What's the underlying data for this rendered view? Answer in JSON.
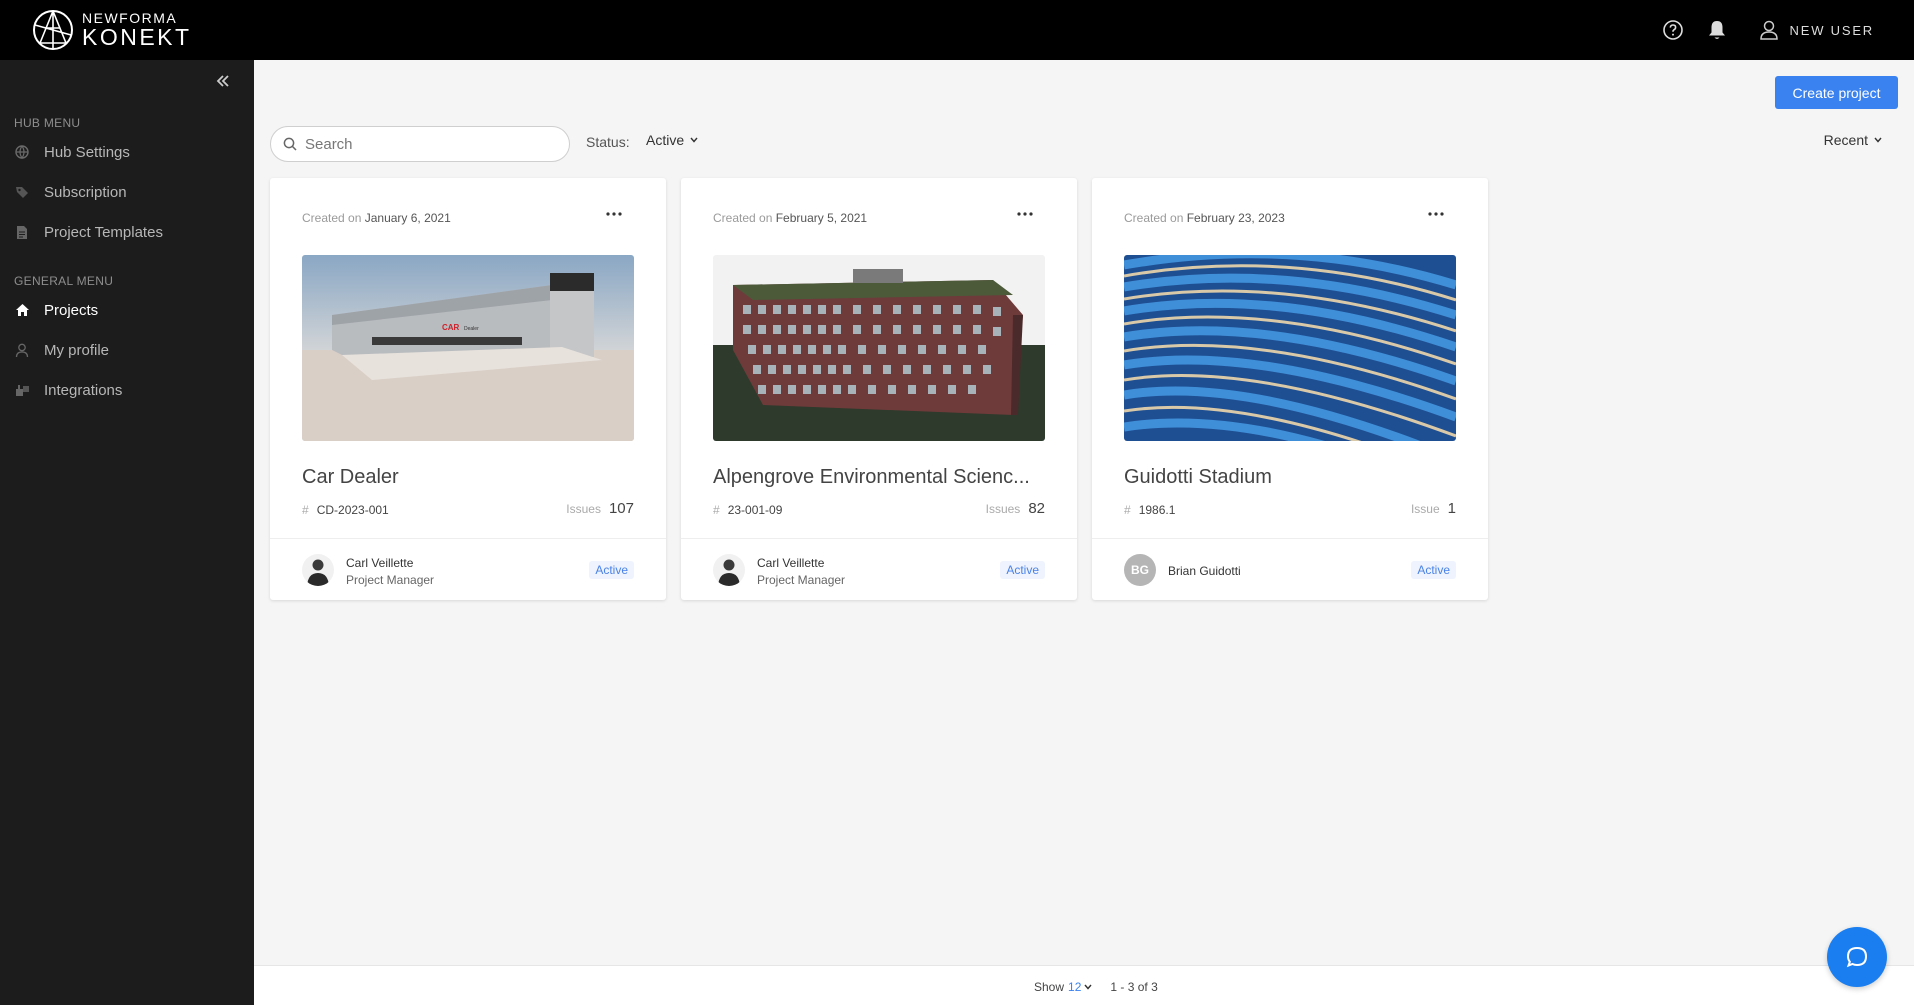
{
  "app": {
    "logo_line1": "NEWFORMA",
    "logo_line2": "KONEKT",
    "user_name": "NEW USER"
  },
  "sidebar": {
    "hub_heading": "HUB MENU",
    "hub_items": [
      {
        "label": "Hub Settings",
        "icon": "globe-icon"
      },
      {
        "label": "Subscription",
        "icon": "tag-icon"
      },
      {
        "label": "Project Templates",
        "icon": "document-icon"
      }
    ],
    "general_heading": "GENERAL MENU",
    "general_items": [
      {
        "label": "Projects",
        "icon": "home-icon",
        "active": true
      },
      {
        "label": "My profile",
        "icon": "user-icon"
      },
      {
        "label": "Integrations",
        "icon": "plug-icon"
      }
    ]
  },
  "toolbar": {
    "create_label": "Create project",
    "search_placeholder": "Search",
    "status_label": "Status:",
    "status_value": "Active",
    "sort_value": "Recent"
  },
  "projects": [
    {
      "created_prefix": "Created on",
      "created_date": "January 6, 2021",
      "title": "Car Dealer",
      "number": "CD-2023-001",
      "issues_label": "Issues",
      "issues": "107",
      "owner_name": "Carl Veillette",
      "owner_role": "Project Manager",
      "status": "Active",
      "thumb_text": "CAR",
      "thumb_text2": "Dealer"
    },
    {
      "created_prefix": "Created on",
      "created_date": "February 5, 2021",
      "title": "Alpengrove Environmental Scienc...",
      "number": "23-001-09",
      "issues_label": "Issues",
      "issues": "82",
      "owner_name": "Carl Veillette",
      "owner_role": "Project Manager",
      "status": "Active"
    },
    {
      "created_prefix": "Created on",
      "created_date": "February 23, 2023",
      "title": "Guidotti Stadium",
      "number": "1986.1",
      "issues_label": "Issue",
      "issues": "1",
      "owner_name": "Brian Guidotti",
      "owner_initials": "BG",
      "status": "Active"
    }
  ],
  "pagination": {
    "show_label": "Show",
    "show_value": "12",
    "range": "1 - 3 of 3"
  },
  "colors": {
    "accent": "#3a82f0",
    "sidebar_bg": "#1c1c1c",
    "topbar_bg": "#000000",
    "badge_text": "#4a82e8"
  }
}
